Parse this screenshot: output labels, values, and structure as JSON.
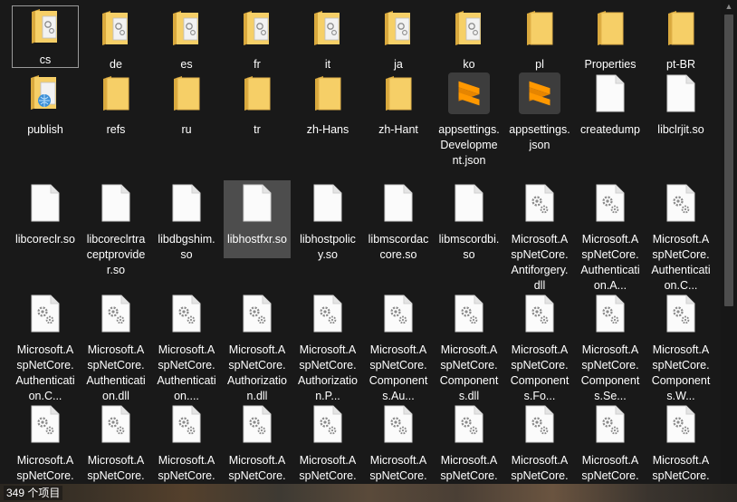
{
  "window": {
    "title": ""
  },
  "status_bar": {
    "item_count": "349 个项目"
  },
  "files": [
    {
      "label": "cs",
      "icon": "folder-doc-icon"
    },
    {
      "label": "de",
      "icon": "folder-doc-icon"
    },
    {
      "label": "es",
      "icon": "folder-doc-icon"
    },
    {
      "label": "fr",
      "icon": "folder-doc-icon"
    },
    {
      "label": "it",
      "icon": "folder-doc-icon"
    },
    {
      "label": "ja",
      "icon": "folder-doc-icon"
    },
    {
      "label": "ko",
      "icon": "folder-doc-icon"
    },
    {
      "label": "pl",
      "icon": "folder-icon"
    },
    {
      "label": "Properties",
      "icon": "folder-icon"
    },
    {
      "label": "pt-BR",
      "icon": "folder-icon"
    },
    {
      "label": "publish",
      "icon": "folder-web-icon"
    },
    {
      "label": "refs",
      "icon": "folder-icon"
    },
    {
      "label": "ru",
      "icon": "folder-icon"
    },
    {
      "label": "tr",
      "icon": "folder-icon"
    },
    {
      "label": "zh-Hans",
      "icon": "folder-icon"
    },
    {
      "label": "zh-Hant",
      "icon": "folder-icon"
    },
    {
      "label": "appsettings.Development.json",
      "icon": "sublime-icon"
    },
    {
      "label": "appsettings.json",
      "icon": "sublime-icon"
    },
    {
      "label": "createdump",
      "icon": "blank-file-icon"
    },
    {
      "label": "libclrjit.so",
      "icon": "blank-file-icon"
    },
    {
      "label": "libcoreclr.so",
      "icon": "blank-file-icon"
    },
    {
      "label": "libcoreclrtraceptprovider.so",
      "icon": "blank-file-icon"
    },
    {
      "label": "libdbgshim.so",
      "icon": "blank-file-icon"
    },
    {
      "label": "libhostfxr.so",
      "icon": "blank-file-icon"
    },
    {
      "label": "libhostpolicy.so",
      "icon": "blank-file-icon"
    },
    {
      "label": "libmscordaccore.so",
      "icon": "blank-file-icon"
    },
    {
      "label": "libmscordbi.so",
      "icon": "blank-file-icon"
    },
    {
      "label": "Microsoft.AspNetCore.Antiforgery.dll",
      "icon": "dll-icon"
    },
    {
      "label": "Microsoft.AspNetCore.Authentication.A...",
      "icon": "dll-icon"
    },
    {
      "label": "Microsoft.AspNetCore.Authentication.C...",
      "icon": "dll-icon"
    },
    {
      "label": "Microsoft.AspNetCore.Authentication.C...",
      "icon": "dll-icon"
    },
    {
      "label": "Microsoft.AspNetCore.Authentication.dll",
      "icon": "dll-icon"
    },
    {
      "label": "Microsoft.AspNetCore.Authentication....",
      "icon": "dll-icon"
    },
    {
      "label": "Microsoft.AspNetCore.Authorization.dll",
      "icon": "dll-icon"
    },
    {
      "label": "Microsoft.AspNetCore.Authorization.P...",
      "icon": "dll-icon"
    },
    {
      "label": "Microsoft.AspNetCore.Components.Au...",
      "icon": "dll-icon"
    },
    {
      "label": "Microsoft.AspNetCore.Components.dll",
      "icon": "dll-icon"
    },
    {
      "label": "Microsoft.AspNetCore.Components.Fo...",
      "icon": "dll-icon"
    },
    {
      "label": "Microsoft.AspNetCore.Components.Se...",
      "icon": "dll-icon"
    },
    {
      "label": "Microsoft.AspNetCore.Components.W...",
      "icon": "dll-icon"
    },
    {
      "label": "Microsoft.AspNetCore.Cookies",
      "icon": "dll-icon"
    },
    {
      "label": "Microsoft.AspNetCore.Core.dll",
      "icon": "dll-icon"
    },
    {
      "label": "Microsoft.AspNetCore.Cors.dll",
      "icon": "dll-icon"
    },
    {
      "label": "Microsoft.AspNetCore.Cryptography",
      "icon": "dll-icon"
    },
    {
      "label": "Microsoft.AspNetCore.Cryptography",
      "icon": "dll-icon"
    },
    {
      "label": "Microsoft.AspNetCore.DataProtection",
      "icon": "dll-icon"
    },
    {
      "label": "Microsoft.AspNetCore.DataProtection",
      "icon": "dll-icon"
    },
    {
      "label": "Microsoft.AspNetCore.DataProtection",
      "icon": "dll-icon"
    },
    {
      "label": "Microsoft.AspNetCore.Diagnostics",
      "icon": "dll-icon"
    },
    {
      "label": "Microsoft.AspNetCore.Diagnostics",
      "icon": "dll-icon"
    }
  ],
  "selected_index": 23,
  "focused_index": 0
}
